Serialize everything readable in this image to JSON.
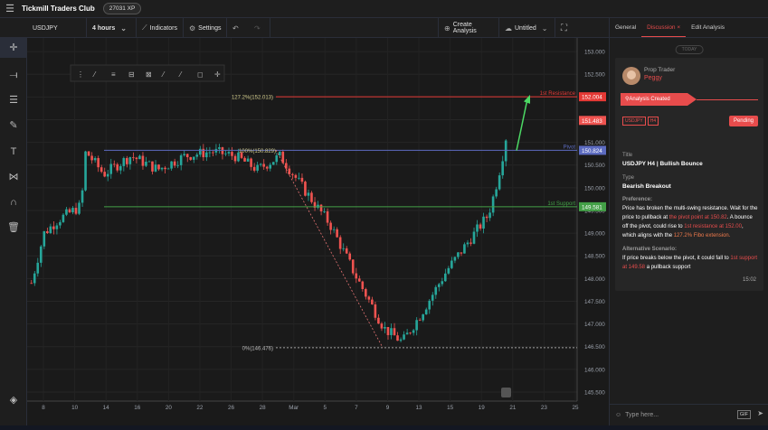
{
  "app": {
    "title": "Tickmill Traders Club",
    "xp": "27031 XP"
  },
  "toolbar": {
    "symbol": "USDJPY",
    "interval": "4 hours",
    "indicators": "Indicators",
    "settings": "Settings",
    "create_analysis": "Create Analysis",
    "layout_name": "Untitled"
  },
  "chart_data": {
    "type": "candlestick",
    "y_ticks": [
      "153.000",
      "152.500",
      "152.000",
      "151.500",
      "151.000",
      "150.500",
      "150.000",
      "149.500",
      "149.000",
      "148.500",
      "148.000",
      "147.500",
      "147.000",
      "146.500",
      "146.000",
      "145.500"
    ],
    "x_ticks": [
      "8",
      "10",
      "14",
      "16",
      "20",
      "22",
      "26",
      "28",
      "Mar",
      "5",
      "7",
      "9",
      "13",
      "15",
      "19",
      "21",
      "23",
      "25"
    ],
    "ylim": [
      145.3,
      153.3
    ],
    "levels": [
      {
        "label": "1st Resistance",
        "value": 152.004,
        "price": "152.004",
        "fib_label": "127.2%(152.013)",
        "color": "#e53935"
      },
      {
        "label": "Pivot",
        "value": 150.824,
        "price": "150.824",
        "fib_label": "100%(150.829)",
        "color": "#5c6bc0"
      },
      {
        "label": "1st Support",
        "value": 149.581,
        "price": "149.581",
        "fib_label": "",
        "color": "#43a047"
      },
      {
        "label": "",
        "value": 146.476,
        "price": "",
        "fib_label": "0%(146.476)",
        "color": "#9e9e9e"
      }
    ],
    "last_price": "151.483",
    "last_price_value": 151.483
  },
  "panel": {
    "tabs": [
      "General",
      "Discussion",
      "Edit Analysis"
    ],
    "today": "TODAY",
    "role": "Prop Trader",
    "user": "Peggy",
    "ribbon": "Analysis Created",
    "chips": [
      "USDJPY",
      "H4"
    ],
    "status": "Pending",
    "title_label": "Title",
    "title_value": "USDJPY H4 | Bullish Bounce",
    "type_label": "Type",
    "type_value": "Bearish Breakout",
    "pref_label": "Preference:",
    "pref_1": "Price has broken the multi-swing resistance. Wait for the price to pullback at ",
    "pref_2": "the pivot point at 150.82",
    "pref_3": ". A bounce off the pivot, could rise to ",
    "pref_4": "1st resistance at 152.00",
    "pref_5": ", which aligns with the ",
    "pref_6": "127.2% Fibo extension.",
    "alt_label": "Alternative Scenario:",
    "alt_1": "If price breaks below the pivot, it could fall to ",
    "alt_2": "1st support at 149.58",
    "alt_3": " a pullback support",
    "time": "15:02",
    "input_placeholder": "Type here...",
    "gif": "GIF"
  }
}
